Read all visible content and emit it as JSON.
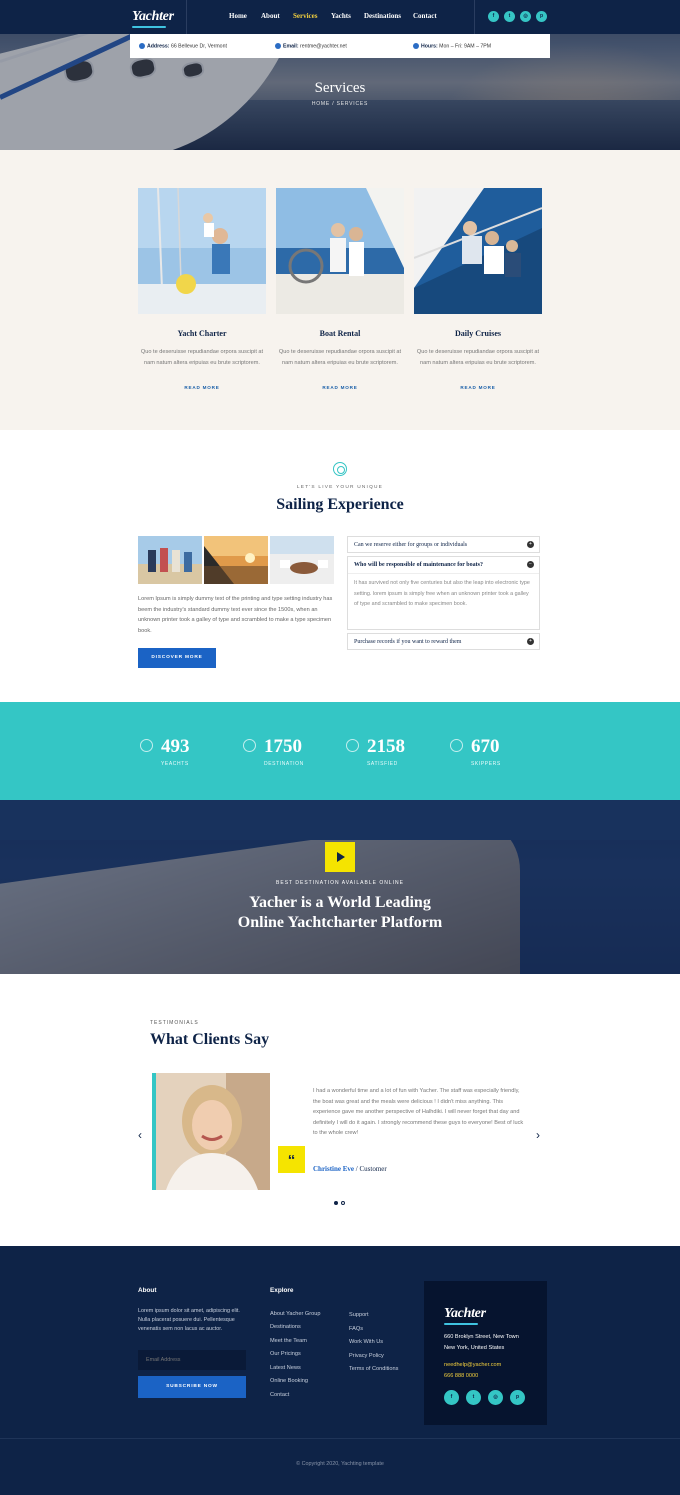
{
  "brand": {
    "name": "Yachter"
  },
  "nav": {
    "items": [
      "Home",
      "About",
      "Services",
      "Yachts",
      "Destinations",
      "Contact"
    ],
    "active": "Services"
  },
  "social": [
    "facebook-icon",
    "twitter-icon",
    "instagram-icon",
    "pinterest-icon"
  ],
  "social_glyphs": {
    "facebook": "f",
    "twitter": "t",
    "instagram": "◎",
    "pinterest": "p"
  },
  "infobar": {
    "address_label": "Address:",
    "address_value": "66 Bellevue Dr, Vermont",
    "email_label": "Email:",
    "email_value": "rentme@yachter.net",
    "hours_label": "Hours:",
    "hours_value": "Mon – Fri: 9AM – 7PM"
  },
  "page": {
    "title": "Services",
    "breadcrumb": "HOME / SERVICES"
  },
  "services": [
    {
      "title": "Yacht Charter",
      "text": "Quo te deseruisse repudiandae orpora suscipit at nam natum altera eripuias eu brute scriptorem.",
      "link": "READ MORE"
    },
    {
      "title": "Boat Rental",
      "text": "Quo te deseruisse repudiandae orpora suscipit at nam natum altera eripuias eu brute scriptorem.",
      "link": "READ MORE"
    },
    {
      "title": "Daily Cruises",
      "text": "Quo te deseruisse repudiandae orpora suscipit at nam natum altera eripuias eu brute scriptorem.",
      "link": "READ MORE"
    }
  ],
  "experience": {
    "kicker": "LET'S LIVE YOUR UNIQUE",
    "title": "Sailing Experience",
    "body": "Lorem Ipsum is simply dummy text of the printing and type setting industry has beem the industry's standard dummy text ever since the 1500s, when an unknown printer took a galley of type and scrambled to make a type specimen book.",
    "button": "DISCOVER MORE",
    "faq": [
      {
        "q": "Can we reserve either for groups or individuals",
        "open": false
      },
      {
        "q": "Who will be responsible of maintenance for boats?",
        "open": true,
        "a": "It has survived not only five centuries but also the leap into electronic type setting. lorem ipsum is simply free when an unknown printer took a galley of type and scrambled to make specimen book."
      },
      {
        "q": "Purchase records if you want to reward them",
        "open": false
      }
    ]
  },
  "stats": [
    {
      "value": "493",
      "label": "YEACHTS",
      "icon": "sailboat-icon"
    },
    {
      "value": "1750",
      "label": "DESTINATION",
      "icon": "island-icon"
    },
    {
      "value": "2158",
      "label": "SATISFIED",
      "icon": "smile-icon"
    },
    {
      "value": "670",
      "label": "SKIPPERS",
      "icon": "lifebuoy-icon"
    }
  ],
  "video": {
    "kicker": "BEST DESTINATION AVAILABLE ONLINE",
    "title_line1": "Yacher is a World Leading",
    "title_line2": "Online Yachtcharter Platform"
  },
  "testimonials": {
    "kicker": "TESTIMONIALS",
    "title": "What Clients Say",
    "quote_mark": "“",
    "text": "I had a wonderful time and a lot of fun with Yacher. The staff was especially friendly, the boat was great and the meals were delicious ! I didn't miss anything. This experience gave me another perspective of Halhdiki. I will never forget that day and definitely I will do it again. I strongly recommend these guys to everyone! Best of luck to the whole crew!",
    "name": "Christine Eve",
    "sep": " / ",
    "role": "Customer",
    "prev": "‹",
    "next": "›"
  },
  "footer": {
    "about_title": "About",
    "about_text": "Lorem ipsum dolor sit amet, adipiscing elit. Nulla placerat posuere dui. Pellentesque venenatis sem non lacus ac auctor.",
    "email_placeholder": "Email Address",
    "subscribe": "SUBSCRIBE NOW",
    "explore_title": "Explore",
    "links_col1": [
      "About Yacher Group",
      "Destinations",
      "Meet the Team",
      "Our Pricings",
      "Latest News",
      "Online Booking",
      "Contact"
    ],
    "links_col2": [
      "Support",
      "FAQs",
      "Work With Us",
      "Privacy Policy",
      "Terms of Conditions"
    ],
    "address1": "660 Broklyn Street, New Town",
    "address2": "New York, United States",
    "email": "needhelp@yacher.com",
    "phone": "666 888 0000",
    "copyright": "© Copyright 2020, Yachting template"
  },
  "colors": {
    "navy": "#0e2347",
    "teal": "#34c6c5",
    "yellow": "#f5e400",
    "blue": "#1b63c5"
  }
}
